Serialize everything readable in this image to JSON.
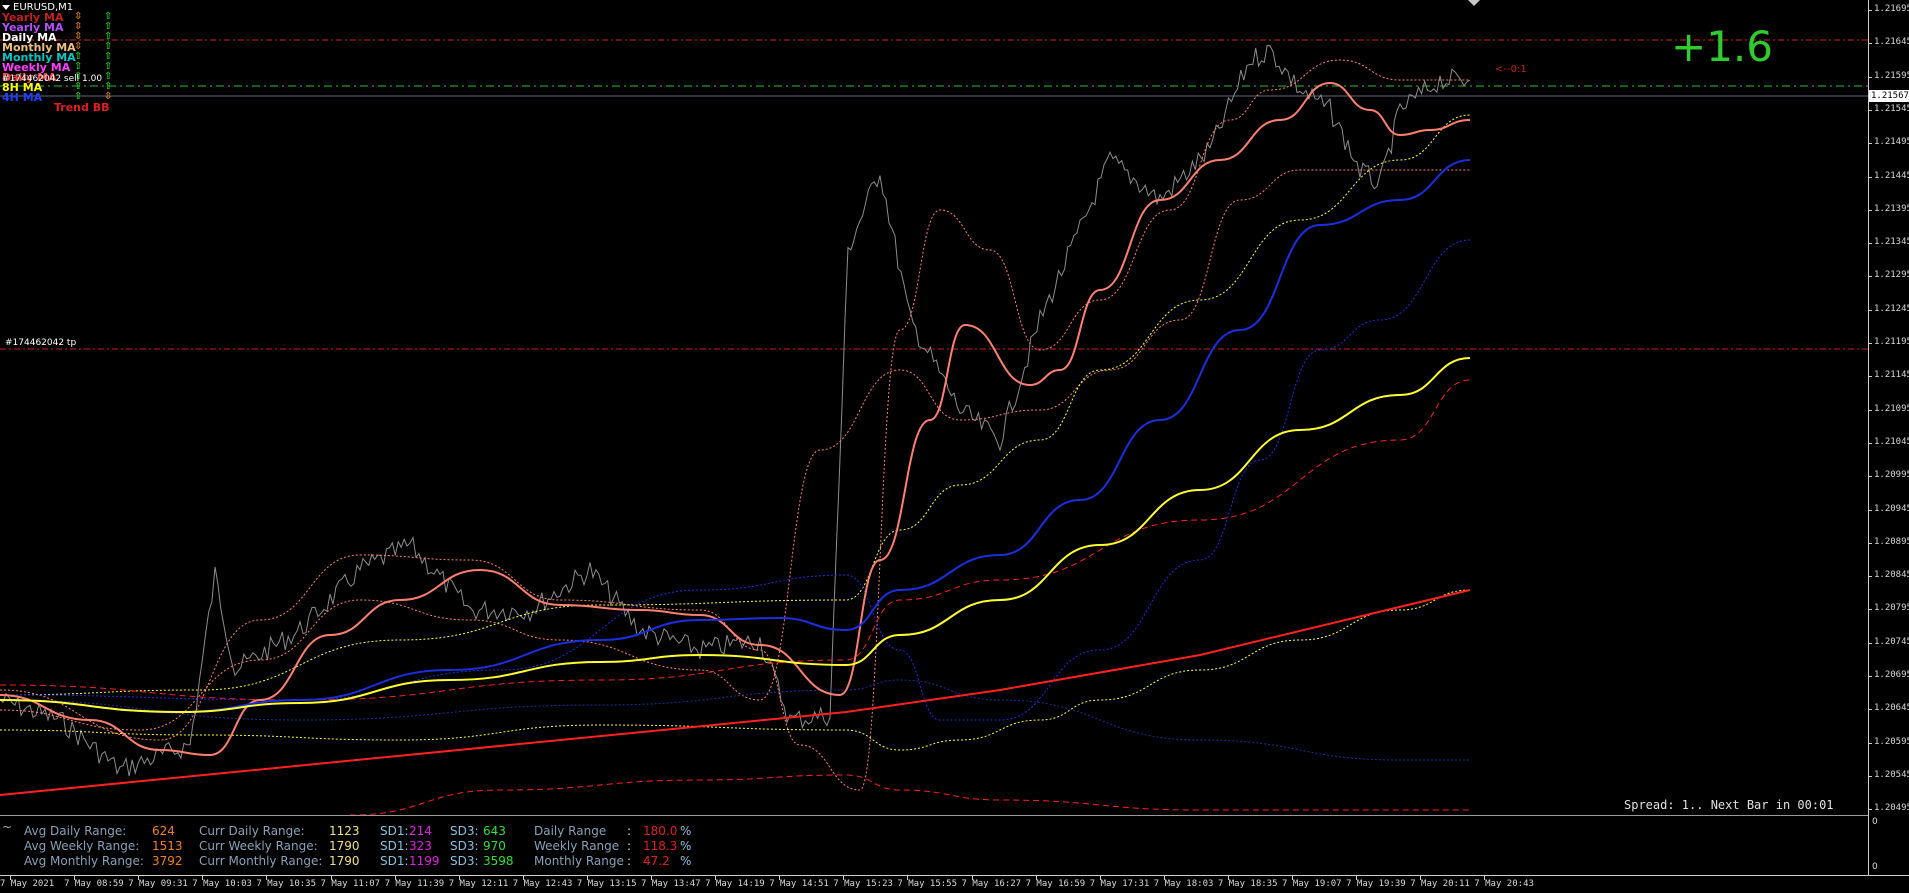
{
  "window": {
    "symbol_title": "EURUSD,M1"
  },
  "legend": {
    "items": [
      {
        "label": "Yearly MA",
        "color": "#c02020"
      },
      {
        "label": "Yearly MA",
        "color": "#b050ff"
      },
      {
        "label": "Daily MA",
        "color": "#ffffff"
      },
      {
        "label": "Monthly MA",
        "color": "#f0c080"
      },
      {
        "label": "Monthly MA",
        "color": "#00c8c8"
      },
      {
        "label": "Weekly MA",
        "color": "#ff40ff"
      },
      {
        "label": "Daily MA",
        "color": "#ff4040"
      },
      {
        "label": "8H MA",
        "color": "#ffff00"
      },
      {
        "label": "4H MA",
        "color": "#2040ff"
      }
    ],
    "arrow_glyph": "⇧",
    "arrow_glyph_alt": "⇳",
    "trend_label": "Trend BB"
  },
  "big_value": "+1.6",
  "order_labels": {
    "sell": "#174462042 sell 1.00",
    "tp": "#174462042 tp",
    "zero": "<--0:1"
  },
  "price_scale": {
    "ticks": [
      "1.21695",
      "1.21645",
      "1.21595",
      "1.21545",
      "1.21495",
      "1.21445",
      "1.21395",
      "1.21345",
      "1.21295",
      "1.21245",
      "1.21195",
      "1.21145",
      "1.21095",
      "1.21045",
      "1.20995",
      "1.20945",
      "1.20895",
      "1.20845",
      "1.20795",
      "1.20745",
      "1.20695",
      "1.20645",
      "1.20595",
      "1.20545",
      "1.20495"
    ],
    "current_price": "1.21567"
  },
  "spread_text": "Spread: 1.. Next Bar in 00:01",
  "stats": {
    "avg_daily_label": "Avg Daily Range:",
    "avg_daily_value": "624",
    "avg_weekly_label": "Avg Weekly Range:",
    "avg_weekly_value": "1513",
    "avg_monthly_label": "Avg Monthly Range:",
    "avg_monthly_value": "3792",
    "curr_daily_label": "Curr Daily Range:",
    "curr_daily_value": "1123",
    "curr_weekly_label": "Curr Weekly Range:",
    "curr_weekly_value": "1790",
    "curr_monthly_label": "Curr Monthly Range:",
    "curr_monthly_value": "1790",
    "sd1_label": "SD1:",
    "sd3_label": "SD3:",
    "sd1_daily": "214",
    "sd3_daily": "643",
    "sd1_weekly": "323",
    "sd3_weekly": "970",
    "sd1_monthly": "1199",
    "sd3_monthly": "3598",
    "daily_range_label": "Daily Range",
    "daily_range_value": "180.0",
    "weekly_range_label": "Weekly Range",
    "weekly_range_value": "118.3",
    "monthly_range_label": "Monthly Range",
    "monthly_range_value": "47.2",
    "colon": ":",
    "pct": "%",
    "tilde": "~"
  },
  "sub_scale": {
    "top": "0",
    "bottom": "0"
  },
  "time_axis": [
    "7 May 2021",
    "7 May 08:59",
    "7 May 09:31",
    "7 May 10:03",
    "7 May 10:35",
    "7 May 11:07",
    "7 May 11:39",
    "7 May 12:11",
    "7 May 12:43",
    "7 May 13:15",
    "7 May 13:47",
    "7 May 14:19",
    "7 May 14:51",
    "7 May 15:23",
    "7 May 15:55",
    "7 May 16:27",
    "7 May 16:59",
    "7 May 17:31",
    "7 May 18:03",
    "7 May 18:35",
    "7 May 19:07",
    "7 May 19:39",
    "7 May 20:11",
    "7 May 20:43"
  ],
  "colors": {
    "price_line": "#8c8c8c",
    "salmon_ma": "#ff8070",
    "blue_ma": "#1a2fe0",
    "yellow_ma": "#ffff30",
    "red_ma": "#ff2020",
    "green_level": "#30c030",
    "red_level": "#d02020",
    "up_arrow": "#20d020",
    "alt_arrow": "#e08020"
  }
}
